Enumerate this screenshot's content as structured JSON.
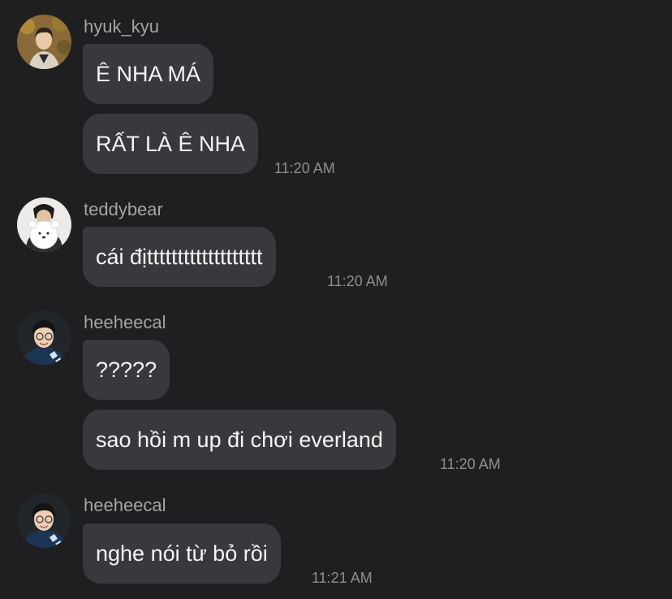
{
  "messages": [
    {
      "user": "hyuk_kyu",
      "lines": [
        "Ê NHA MÁ",
        "RẤT LÀ Ê NHA"
      ],
      "time": "11:20 AM"
    },
    {
      "user": "teddybear",
      "lines": [
        "cái địttttttttttttttttttt"
      ],
      "time": "11:20 AM"
    },
    {
      "user": "heeheecal",
      "lines": [
        "?????",
        "sao hồi m up đi chơi everland"
      ],
      "time": "11:20 AM"
    },
    {
      "user": "heeheecal",
      "lines": [
        "nghe nói từ bỏ rồi"
      ],
      "time": "11:21 AM"
    }
  ],
  "colors": {
    "background": "#1f1f21",
    "bubble": "#39393d",
    "message_text": "#f5f5f7",
    "username_text": "#a4a4a8",
    "timestamp_text": "#8e8e93"
  }
}
